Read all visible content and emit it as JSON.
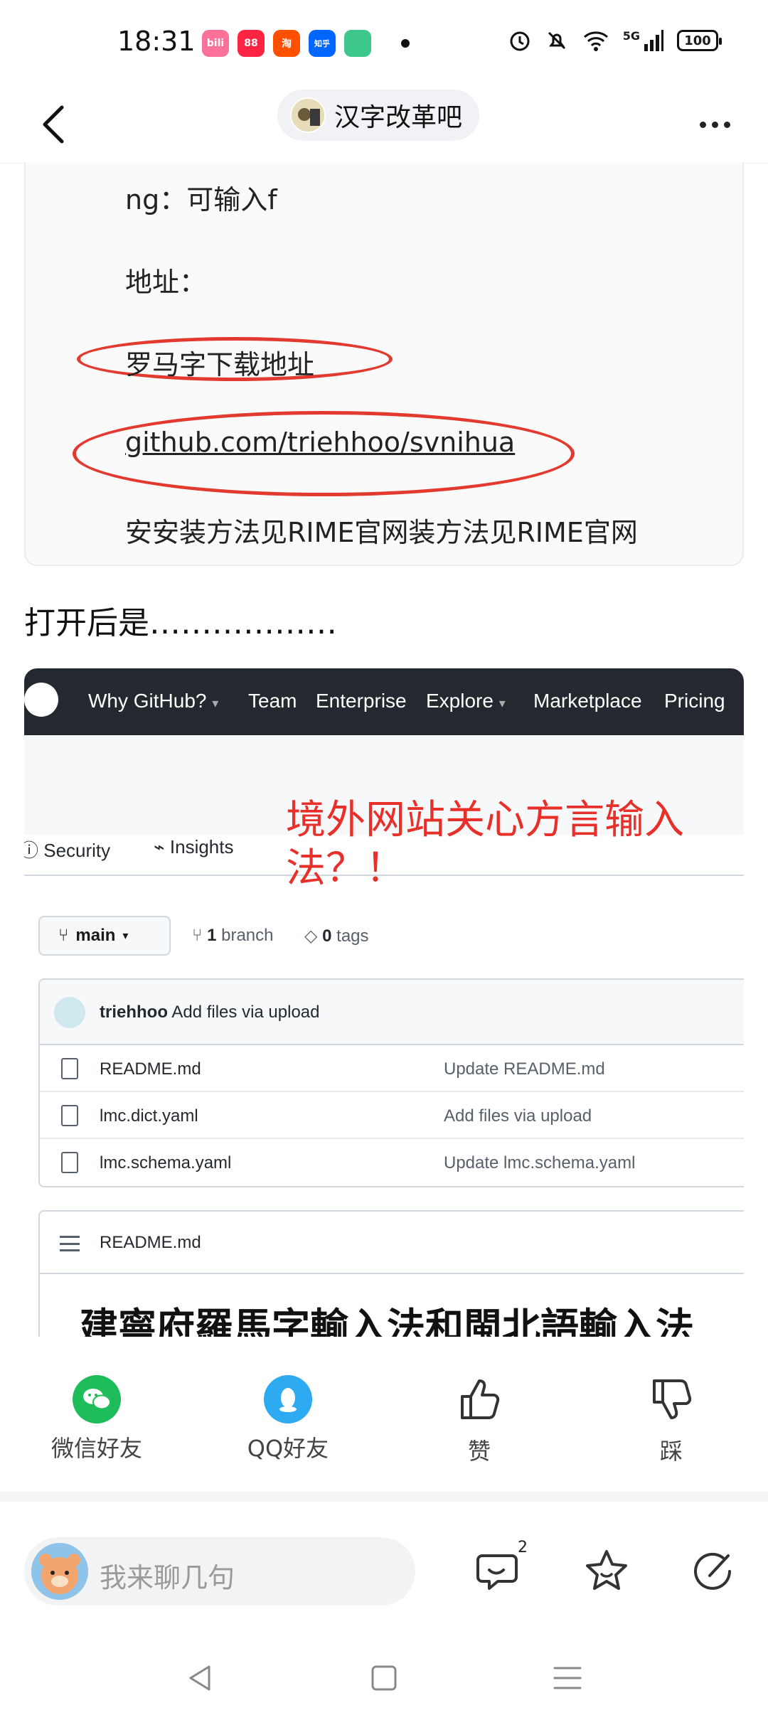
{
  "status_bar": {
    "time": "18:31",
    "apps": [
      {
        "name": "bilibili-icon",
        "label": "bili",
        "color": "#fb7299"
      },
      {
        "name": "xiaohongshu-icon",
        "label": "88",
        "color": "#ff2442"
      },
      {
        "name": "taobao-icon",
        "label": "淘",
        "color": "#ff5000"
      },
      {
        "name": "zhihu-icon",
        "label": "知乎",
        "color": "#0066ff"
      },
      {
        "name": "app-icon",
        "label": "",
        "color": "#3ec78a"
      }
    ],
    "network": "5G",
    "battery": "100"
  },
  "top_nav": {
    "forum_name": "汉字改革吧"
  },
  "doc_image": {
    "line1": "ng：可输入f",
    "line2": "地址：",
    "line3": "罗马字下载地址",
    "link": "github.com/triehhoo/svnihua",
    "line5": "安安装方法见RIME官网装方法见RIME官网"
  },
  "post": {
    "text": "打开后是………………"
  },
  "github_image": {
    "nav": [
      "Why GitHub?",
      "Team",
      "Enterprise",
      "Explore",
      "Marketplace",
      "Pricing"
    ],
    "tabs": [
      "Security",
      "Insights"
    ],
    "red_note": "境外网站关心方言输入法？！",
    "branch": "main",
    "branch_count": "1",
    "branch_label": "branch",
    "tag_count": "0",
    "tag_label": "tags",
    "commit_user": "triehhoo",
    "commit_msg": "Add files via upload",
    "files": [
      {
        "name": "README.md",
        "msg": "Update README.md"
      },
      {
        "name": "lmc.dict.yaml",
        "msg": "Add files via upload"
      },
      {
        "name": "lmc.schema.yaml",
        "msg": "Update lmc.schema.yaml"
      }
    ],
    "readme_label": "README.md",
    "readme_title": "建寧府羅馬字輸入法和閩北語輸入法"
  },
  "actions": {
    "wechat": "微信好友",
    "qq": "QQ好友",
    "like": "赞",
    "dislike": "踩"
  },
  "bottom_bar": {
    "placeholder": "我来聊几句",
    "comment_badge": "2"
  },
  "colors": {
    "wechat": "#1fbc5a",
    "qq": "#2eaaf2",
    "annotation_red": "#e23a2e",
    "github_dark": "#24292f"
  }
}
